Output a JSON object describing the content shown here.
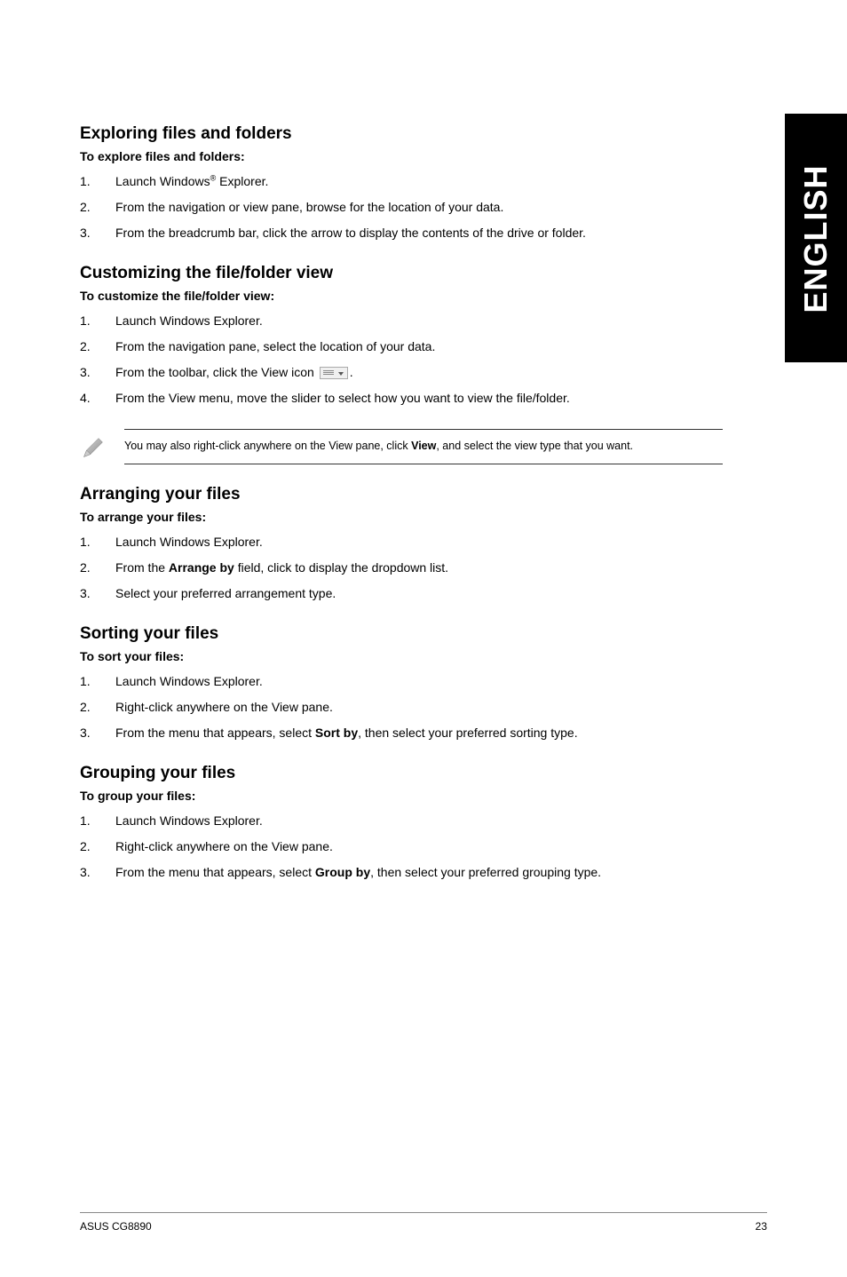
{
  "sideTab": "ENGLISH",
  "sections": {
    "exploring": {
      "heading": "Exploring files and folders",
      "sub": "To explore files and folders:",
      "items": [
        {
          "num": "1.",
          "html": "Launch Windows<span class='sup'>®</span> Explorer."
        },
        {
          "num": "2.",
          "text": "From the navigation or view pane, browse for the location of your data."
        },
        {
          "num": "3.",
          "text": "From the breadcrumb bar, click the arrow to display the contents of the drive or folder."
        }
      ]
    },
    "customizing": {
      "heading": "Customizing the file/folder view",
      "sub": "To customize the file/folder view:",
      "items": [
        {
          "num": "1.",
          "text": "Launch Windows Explorer."
        },
        {
          "num": "2.",
          "text": "From the navigation pane, select the location of your data."
        },
        {
          "num": "3.",
          "html": "From the toolbar, click the View icon <span class='view-icon' data-name='view-dropdown-icon' data-interactable='false'></span>."
        },
        {
          "num": "4.",
          "text": "From the View menu, move the slider to select how you want to view the file/folder."
        }
      ]
    },
    "note": {
      "html": "You may also right-click anywhere on the View pane, click <b>View</b>, and select the view type that you want."
    },
    "arranging": {
      "heading": "Arranging your files",
      "sub": "To arrange your files:",
      "items": [
        {
          "num": "1.",
          "text": "Launch Windows Explorer."
        },
        {
          "num": "2.",
          "html": "From the <b>Arrange by</b> field, click to display the dropdown list."
        },
        {
          "num": "3.",
          "text": "Select your preferred arrangement type."
        }
      ]
    },
    "sorting": {
      "heading": "Sorting your files",
      "sub": "To sort your files:",
      "items": [
        {
          "num": "1.",
          "text": "Launch Windows Explorer."
        },
        {
          "num": "2.",
          "text": "Right-click anywhere on the View pane."
        },
        {
          "num": "3.",
          "html": "From the menu that appears, select <b>Sort by</b>, then select your preferred sorting type."
        }
      ]
    },
    "grouping": {
      "heading": "Grouping your files",
      "sub": "To group your files:",
      "items": [
        {
          "num": "1.",
          "text": "Launch Windows Explorer."
        },
        {
          "num": "2.",
          "text": "Right-click anywhere on the View pane."
        },
        {
          "num": "3.",
          "html": "From the menu that appears, select <b>Group by</b>, then select your preferred grouping type."
        }
      ]
    }
  },
  "footer": {
    "left": "ASUS CG8890",
    "right": "23"
  }
}
